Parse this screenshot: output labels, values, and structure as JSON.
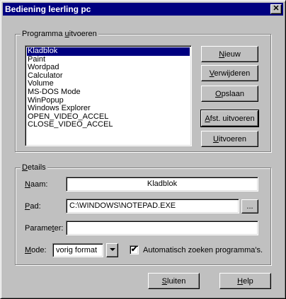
{
  "window": {
    "title": "Bediening leerling pc",
    "close_glyph": "✕"
  },
  "programs_group": {
    "title": "Programma uitvoeren",
    "items": [
      "Kladblok",
      "Paint",
      "Wordpad",
      "Calculator",
      "Volume",
      "MS-DOS Mode",
      "WinPopup",
      "Windows Explorer",
      "OPEN_VIDEO_ACCEL",
      "CLOSE_VIDEO_ACCEL"
    ],
    "selected_index": 0,
    "buttons": {
      "new": "Nieuw",
      "remove": "Verwijderen",
      "save": "Opslaan",
      "run_separate": "Afst. uitvoeren",
      "run": "Uitvoeren"
    }
  },
  "details_group": {
    "title": "Details",
    "name_label": "Naam:",
    "name_value": "Kladblok",
    "path_label": "Pad:",
    "path_value": "C:\\WINDOWS\\NOTEPAD.EXE",
    "browse_label": "...",
    "parameter_label": "Parameter:",
    "parameter_value": "",
    "mode_label": "Mode:",
    "mode_value": "vorig format",
    "auto_search_label": "Automatisch zoeken programma's.",
    "auto_search_checked": "✔"
  },
  "footer": {
    "close": "Sluiten",
    "help": "Help"
  },
  "colors": {
    "titlebar": "#000080",
    "face": "#c0c0c0",
    "selection": "#000080"
  }
}
